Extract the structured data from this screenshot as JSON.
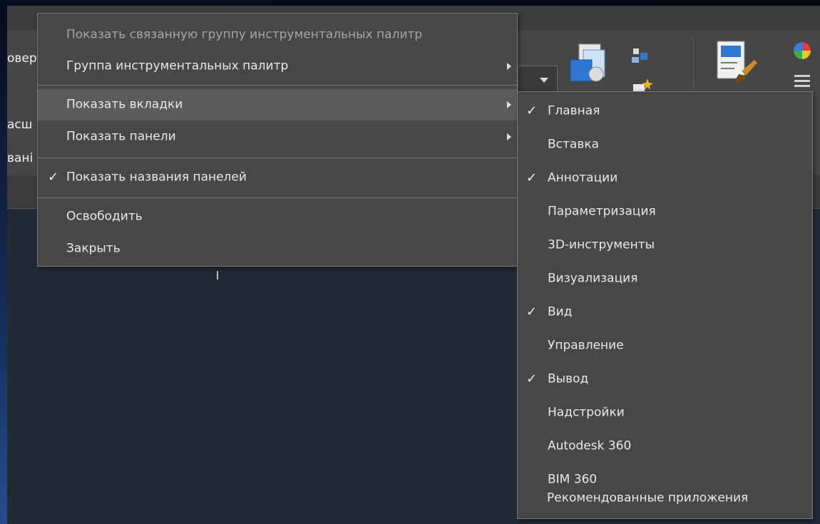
{
  "colors": {
    "menu_bg": "#474747",
    "highlight": "#5b5b5b",
    "disabled_text": "#a6a6a6",
    "text": "#e9e9e9"
  },
  "ribbon": {
    "stubs": [
      "овер",
      "асш",
      "вані"
    ]
  },
  "context_menu": {
    "items": [
      {
        "label": "Показать связанную группу инструментальных палитр",
        "disabled": true
      },
      {
        "label": "Группа инструментальных палитр",
        "submenu": true
      },
      {
        "label": "Показать вкладки",
        "submenu": true,
        "highlighted": true
      },
      {
        "label": "Показать панели",
        "submenu": true
      },
      {
        "label": "Показать названия панелей",
        "checked": true
      },
      {
        "label": "Освободить"
      },
      {
        "label": "Закрыть"
      }
    ]
  },
  "tabs_submenu": {
    "items": [
      {
        "label": "Главная",
        "checked": true
      },
      {
        "label": "Вставка",
        "checked": false
      },
      {
        "label": "Аннотации",
        "checked": true
      },
      {
        "label": "Параметризация",
        "checked": false
      },
      {
        "label": "3D-инструменты",
        "checked": false
      },
      {
        "label": "Визуализация",
        "checked": false
      },
      {
        "label": "Вид",
        "checked": true
      },
      {
        "label": "Управление",
        "checked": false
      },
      {
        "label": "Вывод",
        "checked": true
      },
      {
        "label": "Надстройки",
        "checked": false
      },
      {
        "label": "Autodesk 360",
        "checked": false
      },
      {
        "label": "BIM 360",
        "checked": false
      },
      {
        "label": "Рекомендованные приложения",
        "checked": false
      }
    ]
  },
  "icons": [
    "dropdown-arrow-icon",
    "layout-views-icon",
    "transfer-blocks-icon",
    "sheet-brush-icon",
    "color-wheel-icon",
    "menu-lines-icon",
    "check-icon",
    "submenu-arrow-icon"
  ]
}
